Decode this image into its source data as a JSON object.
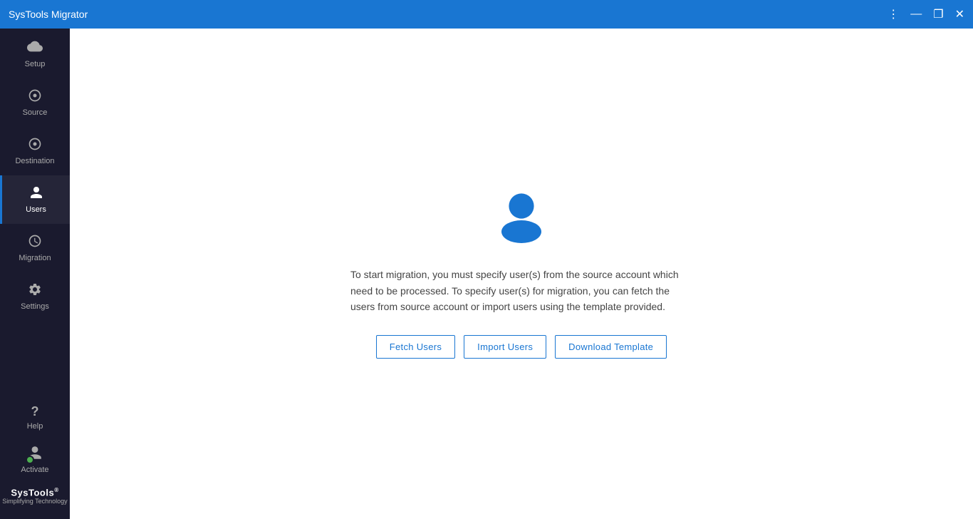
{
  "titleBar": {
    "title": "SysTools Migrator",
    "controls": {
      "menu": "⋮",
      "minimize": "—",
      "maximize": "❐",
      "close": "✕"
    }
  },
  "sidebar": {
    "items": [
      {
        "id": "setup",
        "label": "Setup",
        "icon": "☁",
        "active": false
      },
      {
        "id": "source",
        "label": "Source",
        "icon": "⊙",
        "active": false
      },
      {
        "id": "destination",
        "label": "Destination",
        "icon": "⊙",
        "active": false
      },
      {
        "id": "users",
        "label": "Users",
        "icon": "👤",
        "active": true
      },
      {
        "id": "migration",
        "label": "Migration",
        "icon": "🕐",
        "active": false
      },
      {
        "id": "settings",
        "label": "Settings",
        "icon": "⚙",
        "active": false
      }
    ],
    "bottomItems": [
      {
        "id": "help",
        "label": "Help",
        "icon": "?"
      },
      {
        "id": "activate",
        "label": "Activate",
        "icon": "👤",
        "hasGreenDot": true
      }
    ],
    "brand": {
      "name": "SysTools",
      "trademark": "®",
      "tagline": "Simplifying Technology"
    }
  },
  "mainContent": {
    "descriptionText": "To start migration, you must specify user(s) from the source account which need to be processed. To specify user(s) for migration, you can fetch the users from source account or import users using the template provided.",
    "buttons": {
      "fetchUsers": "Fetch Users",
      "importUsers": "Import Users",
      "downloadTemplate": "Download Template"
    }
  }
}
